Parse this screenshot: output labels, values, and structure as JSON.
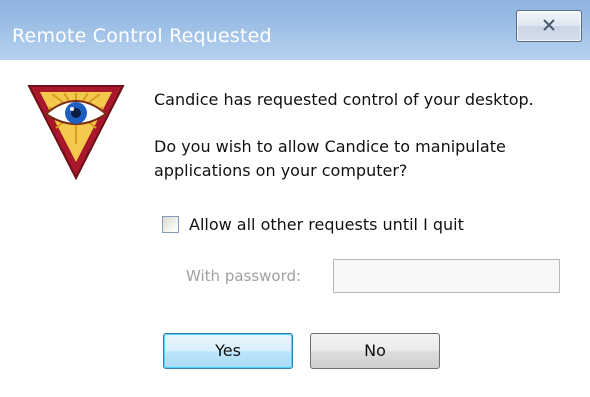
{
  "window": {
    "title": "Remote Control Requested",
    "close_icon": "close-x-icon"
  },
  "logo": {
    "icon": "eye-triangle-logo-icon",
    "colors": {
      "outer": "#a8182a",
      "inner": "#f2c94c",
      "iris": "#1f5fbf"
    }
  },
  "message": {
    "line1": "Candice has requested control of your desktop.",
    "line2": "Do you wish to allow Candice to manipulate",
    "line3": "applications on your computer?"
  },
  "options": {
    "allow_all_label": "Allow all other requests until I quit",
    "allow_all_checked": false,
    "password_label": "With password:",
    "password_value": "",
    "password_enabled": false
  },
  "buttons": {
    "yes_label": "Yes",
    "no_label": "No"
  },
  "colors": {
    "titlebar": "#9ec0e6",
    "default_button_border": "#3c7fb1"
  }
}
